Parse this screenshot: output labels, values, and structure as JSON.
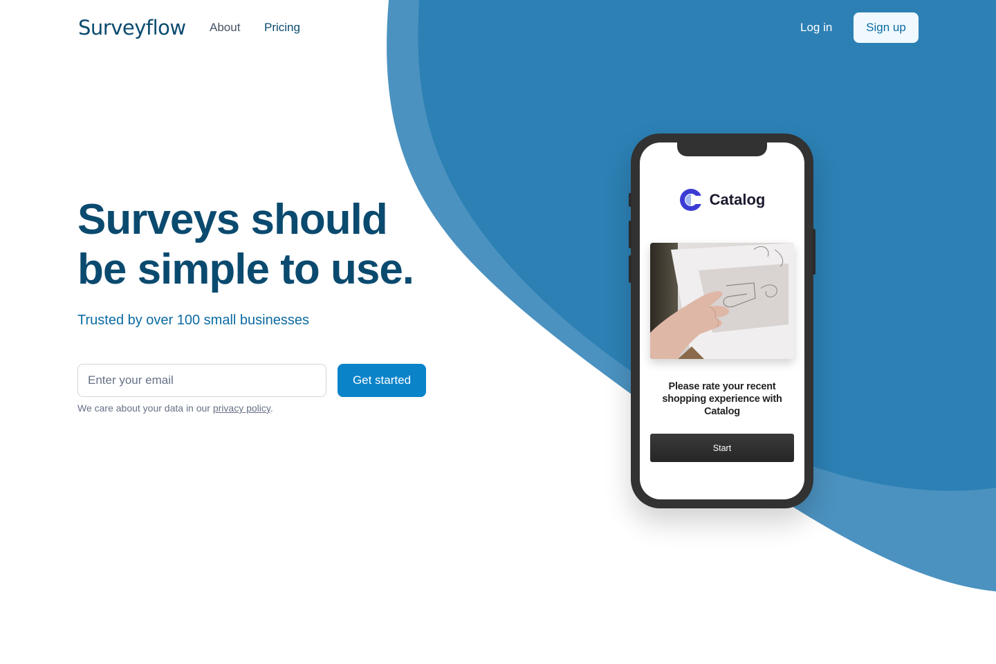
{
  "header": {
    "logo_text": "Surveyflow",
    "nav": [
      {
        "label": "About"
      },
      {
        "label": "Pricing"
      }
    ],
    "login_label": "Log in",
    "signup_label": "Sign up"
  },
  "hero": {
    "title_line1": "Surveys should",
    "title_line2": "be simple to use.",
    "subtitle": "Trusted by over 100 small businesses",
    "email_placeholder": "Enter your email",
    "email_value": "",
    "cta_label": "Get started",
    "privacy_prefix": "We care about your data in our ",
    "privacy_link": "privacy policy",
    "privacy_suffix": "."
  },
  "phone_preview": {
    "brand_name": "Catalog",
    "brand_icon": "catalog-logo-icon",
    "photo": "hand-on-sketchbook-photo",
    "question": "Please rate your recent shopping experience with Catalog",
    "start_label": "Start"
  },
  "colors": {
    "primary_dark": "#0b4a6f",
    "accent": "#0a83c9",
    "blob_main": "#2c80b4",
    "blob_light": "#4b92c0",
    "phone_frame": "#323232"
  }
}
